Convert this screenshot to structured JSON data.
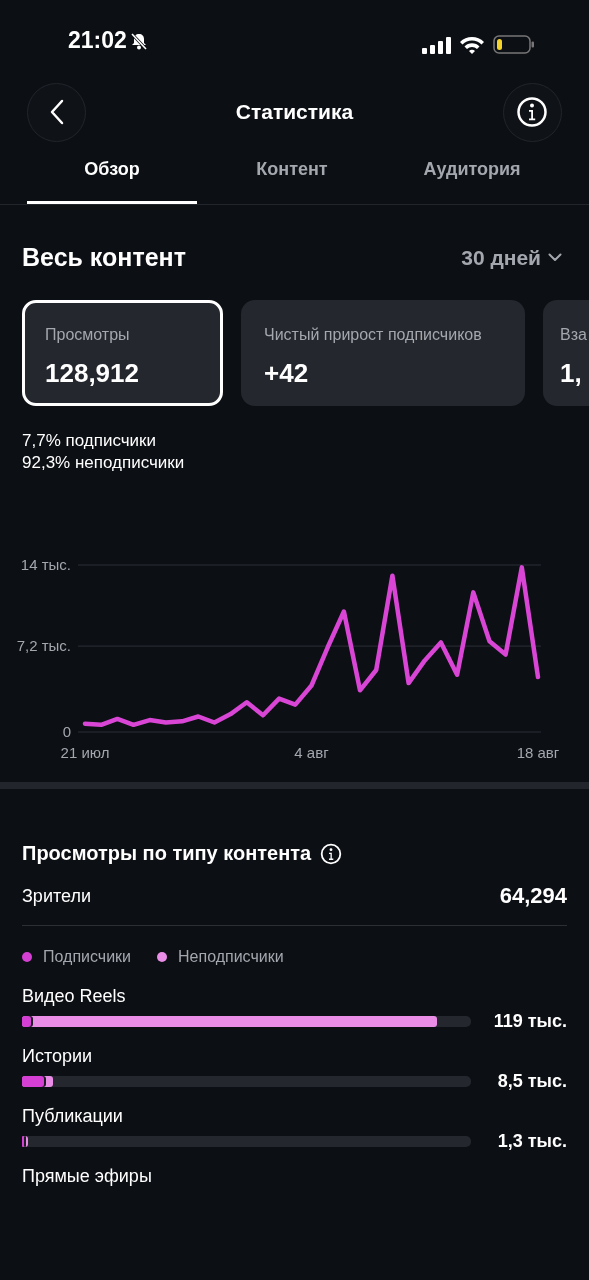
{
  "status_bar": {
    "time": "21:02",
    "silent": true
  },
  "header": {
    "title": "Статистика"
  },
  "tabs": [
    {
      "label": "Обзор",
      "selected": true
    },
    {
      "label": "Контент",
      "selected": false
    },
    {
      "label": "Аудитория",
      "selected": false
    }
  ],
  "section": {
    "title": "Весь контент",
    "period": "30 дней"
  },
  "metric_cards": [
    {
      "label": "Просмотры",
      "value": "128,912",
      "selected": true
    },
    {
      "label": "Чистый прирост подписчиков",
      "value": "+42",
      "selected": false
    },
    {
      "label": "Вза",
      "value": "1,",
      "selected": false
    }
  ],
  "breakdown": [
    "7,7% подписчики",
    "92,3% неподписчики"
  ],
  "chart_data": {
    "type": "line",
    "categories": [
      "21 июл",
      null,
      null,
      null,
      null,
      null,
      null,
      null,
      null,
      null,
      null,
      null,
      null,
      null,
      "4 авг",
      null,
      null,
      null,
      null,
      null,
      null,
      null,
      null,
      null,
      null,
      null,
      null,
      null,
      "18 авг"
    ],
    "series": [
      {
        "color": "#d946d6",
        "values": [
          0.7,
          0.6,
          1.1,
          0.6,
          1.0,
          0.8,
          0.9,
          1.3,
          0.8,
          1.5,
          2.5,
          1.4,
          2.8,
          2.3,
          3.9,
          7.1,
          10.1,
          3.5,
          5.2,
          13.1,
          4.1,
          6.0,
          7.5,
          4.8,
          11.7,
          7.6,
          6.5,
          13.8,
          4.6
        ]
      }
    ],
    "ylim": [
      0,
      14
    ],
    "yticks": [
      0,
      {
        "value": 7.2,
        "label": "7,2 тыс."
      },
      {
        "value": 14,
        "label": "14 тыс."
      }
    ]
  },
  "content_types": {
    "title": "Просмотры по типу контента",
    "viewers_label": "Зрители",
    "viewers_value": "64,294",
    "legend": [
      {
        "label": "Подписчики",
        "color": "#d63fd3"
      },
      {
        "label": "Неподписчики",
        "color": "#ea8de6"
      }
    ],
    "items": [
      {
        "label": "Видео Reels",
        "segments": [
          {
            "level": 0.02
          },
          {
            "level": 0.925
          }
        ],
        "value": "119 тыс."
      },
      {
        "label": "Истории",
        "segments": [
          {
            "level": 0.05
          },
          {
            "level": 0.068
          }
        ],
        "value": "8,5 тыс."
      },
      {
        "label": "Публикации",
        "segments": [
          {
            "level": 0.005
          },
          {
            "level": 0.013
          }
        ],
        "value": "1,3 тыс."
      },
      {
        "label": "Прямые эфиры"
      }
    ]
  }
}
